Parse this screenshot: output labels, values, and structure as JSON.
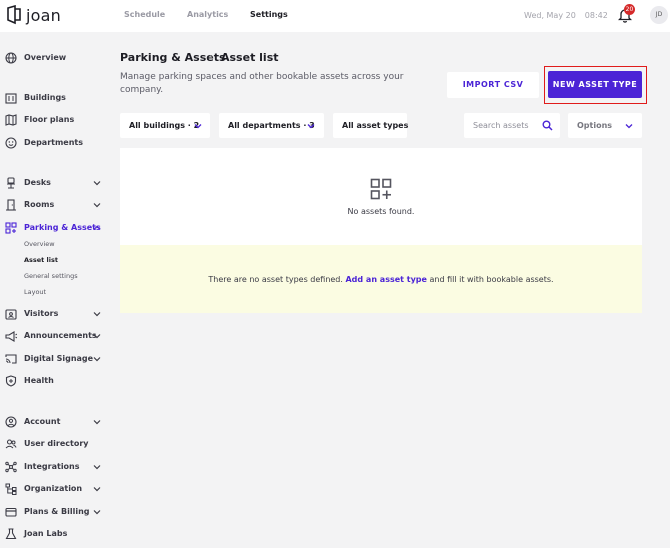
{
  "app": {
    "logo_text": "joan"
  },
  "topnav": {
    "schedule": "Schedule",
    "analytics": "Analytics",
    "settings": "Settings"
  },
  "header": {
    "date": "Wed, May 20",
    "time": "08:42",
    "notification_count": "20",
    "avatar_initials": "JD"
  },
  "sidebar": {
    "overview": "Overview",
    "buildings": "Buildings",
    "floor_plans": "Floor plans",
    "departments": "Departments",
    "desks": "Desks",
    "rooms": "Rooms",
    "parking_assets": "Parking & Assets",
    "parking_sub": [
      "Overview",
      "Asset list",
      "General settings",
      "Layout"
    ],
    "visitors": "Visitors",
    "announcements": "Announcements",
    "digital_signage": "Digital Signage",
    "health": "Health",
    "account": "Account",
    "user_directory": "User directory",
    "integrations": "Integrations",
    "organization": "Organization",
    "plans_billing": "Plans & Billing",
    "joan_labs": "Joan Labs"
  },
  "page": {
    "breadcrumb_parent": "Parking & Assets",
    "breadcrumb_separator": "›",
    "breadcrumb_current": "Asset list",
    "subtitle": "Manage parking spaces and other bookable assets across your company.",
    "import_button": "IMPORT CSV",
    "new_button": "NEW ASSET TYPE"
  },
  "filters": {
    "buildings": "All buildings · 2",
    "departments": "All departments · 3",
    "asset_types": "All asset types",
    "search_placeholder": "Search assets",
    "options": "Options"
  },
  "empty_state": {
    "text": "No assets found."
  },
  "notice": {
    "prefix": "There are no asset types defined.",
    "link": "Add an asset type",
    "suffix": "and fill it with bookable assets."
  },
  "colors": {
    "accent": "#4b24d6",
    "highlight_frame": "#e01b1b",
    "notice_bg": "#fbfce2",
    "badge": "#d52a2a"
  }
}
